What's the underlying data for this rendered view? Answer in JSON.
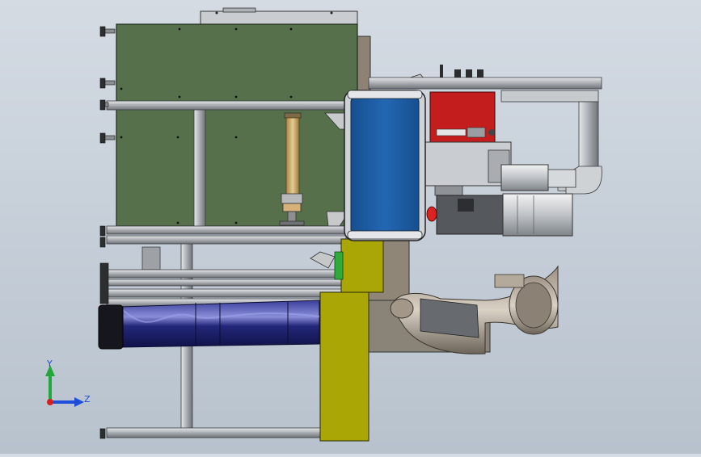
{
  "viewport": {
    "background_top": "#d4dbe3",
    "background_bottom": "#b8c2cd"
  },
  "model": {
    "colors": {
      "green_panel": "#55704a",
      "blue_panel": "#1e5fa8",
      "yellow_plate": "#a9a606",
      "red_box": "#c41d1d",
      "duct_navy": "#1b1e6e",
      "frame_grey": "#b9bdc2",
      "brass_rod": "#c9a766"
    }
  },
  "triad": {
    "y_label": "Y",
    "z_label": "Z",
    "y_color": "#22a83a",
    "z_color": "#1f4fd8",
    "origin_color": "#d42020"
  }
}
